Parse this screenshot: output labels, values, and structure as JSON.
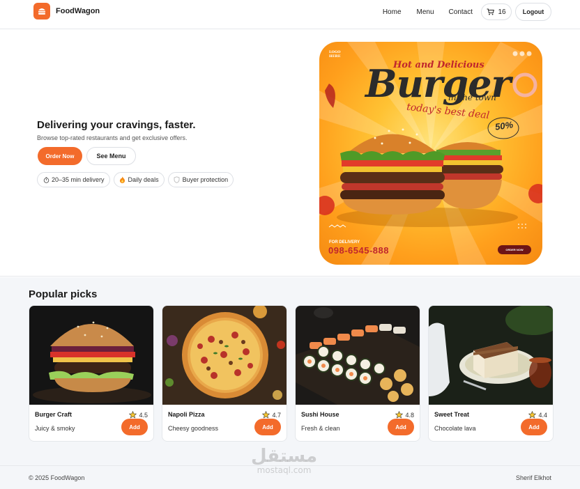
{
  "header": {
    "brand": "FoodWagon",
    "nav": [
      "Home",
      "Menu",
      "Contact"
    ],
    "cart_count": "16",
    "logout_label": "Logout"
  },
  "hero": {
    "title": "Delivering your cravings, faster.",
    "subtitle": "Browse top-rated restaurants and get exclusive offers.",
    "primary_label": "Order Now",
    "secondary_label": "See Menu",
    "chips": [
      {
        "label": "20–35 min delivery",
        "icon": "stopwatch-icon"
      },
      {
        "label": "Daily deals",
        "icon": "flame-icon"
      },
      {
        "label": "Buyer protection",
        "icon": "shield-icon"
      }
    ],
    "poster": {
      "logo_text": "LOGO HERE",
      "tagline": "Hot and Delicious",
      "headline": "Burger",
      "subheadline": "in the town",
      "script": "today's best deal",
      "badge_small": "NEW OFFER",
      "badge_discount": "50%",
      "delivery_label": "FOR DELIVERY",
      "phone": "098-6545-888",
      "order_label": "ORDER NOW"
    }
  },
  "popular": {
    "title": "Popular picks",
    "items": [
      {
        "name": "Burger Craft",
        "rating": "4.5",
        "desc": "Juicy & smoky",
        "add_label": "Add"
      },
      {
        "name": "Napoli Pizza",
        "rating": "4.7",
        "desc": "Cheesy goodness",
        "add_label": "Add"
      },
      {
        "name": "Sushi House",
        "rating": "4.8",
        "desc": "Fresh & clean",
        "add_label": "Add"
      },
      {
        "name": "Sweet Treat",
        "rating": "4.4",
        "desc": "Chocolate lava",
        "add_label": "Add"
      }
    ]
  },
  "footer": {
    "copyright": "© 2025 FoodWagon",
    "author": "Sherif Elkhot",
    "watermark_arabic": "مستقل",
    "watermark_latin": "mostaql.com"
  },
  "colors": {
    "accent": "#f36b2b",
    "text": "#1a1a1a",
    "section_bg": "#f4f6f9"
  }
}
